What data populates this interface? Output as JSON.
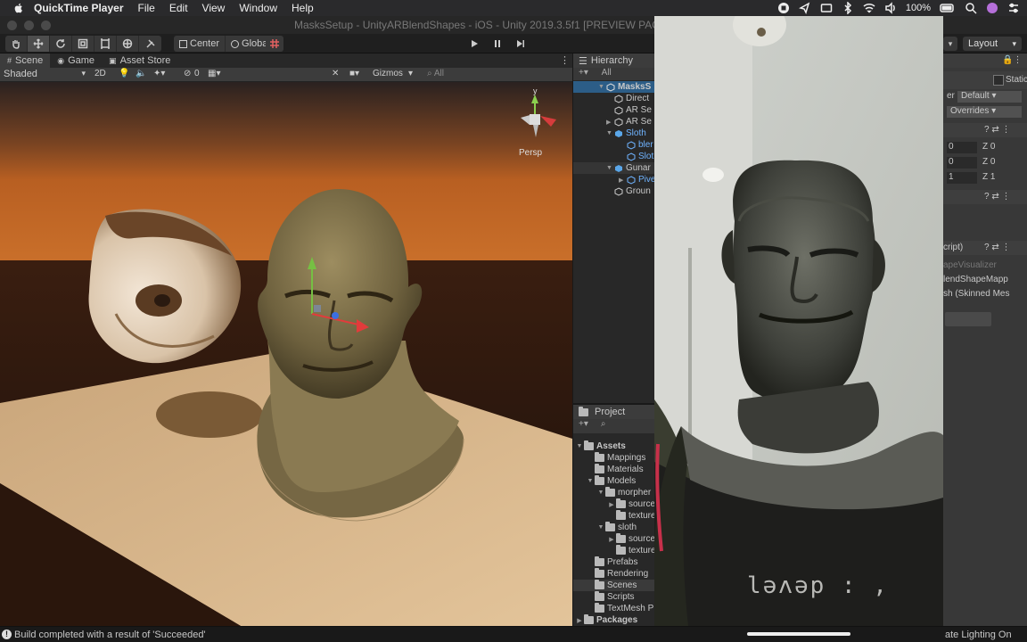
{
  "menubar": {
    "app_name": "QuickTime Player",
    "items": [
      "File",
      "Edit",
      "View",
      "Window",
      "Help"
    ],
    "battery": "100%"
  },
  "window": {
    "title": "MasksSetup - UnityARBlendShapes - iOS - Unity 2019.3.5f1 [PREVIEW PACKAGE"
  },
  "toolbar": {
    "pivot_label": "Center",
    "space_label": "Global",
    "layout_label": "Layout"
  },
  "scene": {
    "tabs": [
      "Scene",
      "Game",
      "Asset Store"
    ],
    "draw_mode": "Shaded",
    "mode_2d": "2D",
    "hidden_count": "0",
    "gizmos_label": "Gizmos",
    "search_placeholder": "All",
    "projection_label": "Persp",
    "axis_y": "y"
  },
  "hierarchy": {
    "tab_label": "Hierarchy",
    "search_placeholder": "All",
    "rows": [
      {
        "label": "MasksS"
      },
      {
        "label": "Direct"
      },
      {
        "label": "AR Se"
      },
      {
        "label": "AR Se"
      },
      {
        "label": "Sloth"
      },
      {
        "label": "bler"
      },
      {
        "label": "Slot"
      },
      {
        "label": "Gunar"
      },
      {
        "label": "Pive"
      },
      {
        "label": "Groun"
      }
    ]
  },
  "project": {
    "tab_label": "Project",
    "rows": [
      {
        "label": "Assets"
      },
      {
        "label": "Mappings"
      },
      {
        "label": "Materials"
      },
      {
        "label": "Models"
      },
      {
        "label": "morpher"
      },
      {
        "label": "source"
      },
      {
        "label": "texture"
      },
      {
        "label": "sloth"
      },
      {
        "label": "source"
      },
      {
        "label": "texture"
      },
      {
        "label": "Prefabs"
      },
      {
        "label": "Rendering"
      },
      {
        "label": "Scenes"
      },
      {
        "label": "Scripts"
      },
      {
        "label": "TextMesh P"
      },
      {
        "label": "Packages"
      }
    ]
  },
  "inspector": {
    "static_label": "Static",
    "layer_label": "er",
    "layer_value": "Default",
    "overrides_label": "Overrides",
    "transform_rows": [
      {
        "x": "0",
        "z": "Z 0"
      },
      {
        "x": "0",
        "z": "Z 0"
      },
      {
        "x": "1",
        "z": "Z 1"
      }
    ],
    "script_label": "cript)",
    "component_lines": [
      "apeVisualizer",
      "lendShapeMapp",
      "sh (Skinned Mes"
    ]
  },
  "phone": {
    "shirt_text": "ləʌəp : ,"
  },
  "status": {
    "message": "Build completed with a result of 'Succeeded'",
    "lighting": "ate Lighting On"
  }
}
